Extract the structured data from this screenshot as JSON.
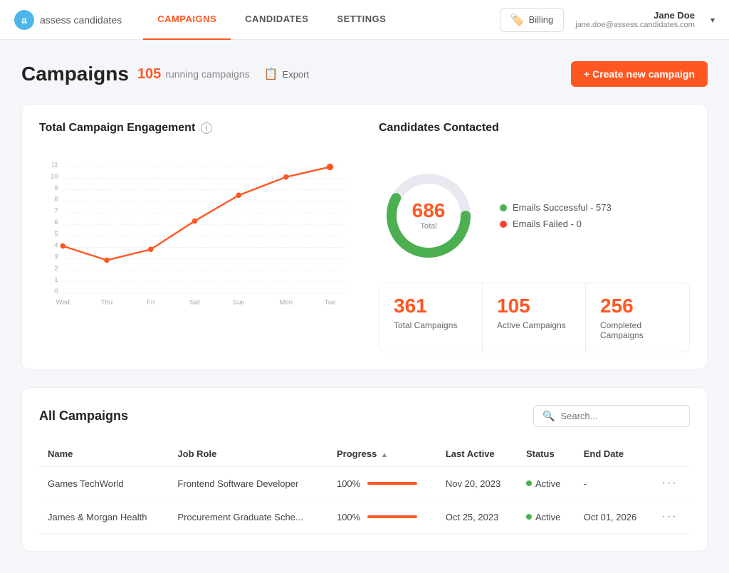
{
  "header": {
    "logo_text": "assess candidates",
    "nav": [
      {
        "label": "CAMPAIGNS",
        "active": true
      },
      {
        "label": "CANDIDATES",
        "active": false
      },
      {
        "label": "SETTINGS",
        "active": false
      }
    ],
    "billing_label": "Billing",
    "user_name": "Jane Doe",
    "user_email": "jane.doe@assess.candidates.com"
  },
  "page": {
    "title": "Campaigns",
    "running_count": "105",
    "running_label": "running campaigns",
    "export_label": "Export",
    "create_label": "+ Create new campaign"
  },
  "engagement": {
    "title": "Total Campaign Engagement",
    "chart": {
      "x_labels": [
        "Wed",
        "Thu",
        "Fri",
        "Sat",
        "Sun",
        "Mon",
        "Tue"
      ],
      "y_labels": [
        "0",
        "1",
        "2",
        "3",
        "4",
        "5",
        "6",
        "7",
        "8",
        "9",
        "10",
        "11"
      ],
      "data_points": [
        4.1,
        2.9,
        3.8,
        6.3,
        8.5,
        10.1,
        11.0
      ]
    }
  },
  "candidates_contacted": {
    "title": "Candidates Contacted",
    "total": "686",
    "total_label": "Total",
    "donut": {
      "success_pct": 83,
      "fail_pct": 0,
      "rest_pct": 17
    },
    "legend": [
      {
        "color": "green",
        "label": "Emails Successful - 573"
      },
      {
        "color": "red",
        "label": "Emails Failed - 0"
      }
    ],
    "stats": [
      {
        "number": "361",
        "label": "Total Campaigns"
      },
      {
        "number": "105",
        "label": "Active Campaigns"
      },
      {
        "number": "256",
        "label": "Completed Campaigns"
      }
    ]
  },
  "campaigns_table": {
    "title": "All Campaigns",
    "search_placeholder": "Search...",
    "columns": [
      "Name",
      "Job Role",
      "Progress",
      "Last Active",
      "Status",
      "End Date",
      ""
    ],
    "rows": [
      {
        "name": "Games TechWorld",
        "job_role": "Frontend Software Developer",
        "progress": "100%",
        "progress_pct": 100,
        "last_active": "Nov 20, 2023",
        "status": "Active",
        "end_date": "-"
      },
      {
        "name": "James & Morgan Health",
        "job_role": "Procurement Graduate Sche...",
        "progress": "100%",
        "progress_pct": 100,
        "last_active": "Oct 25, 2023",
        "status": "Active",
        "end_date": "Oct 01, 2026"
      }
    ]
  }
}
